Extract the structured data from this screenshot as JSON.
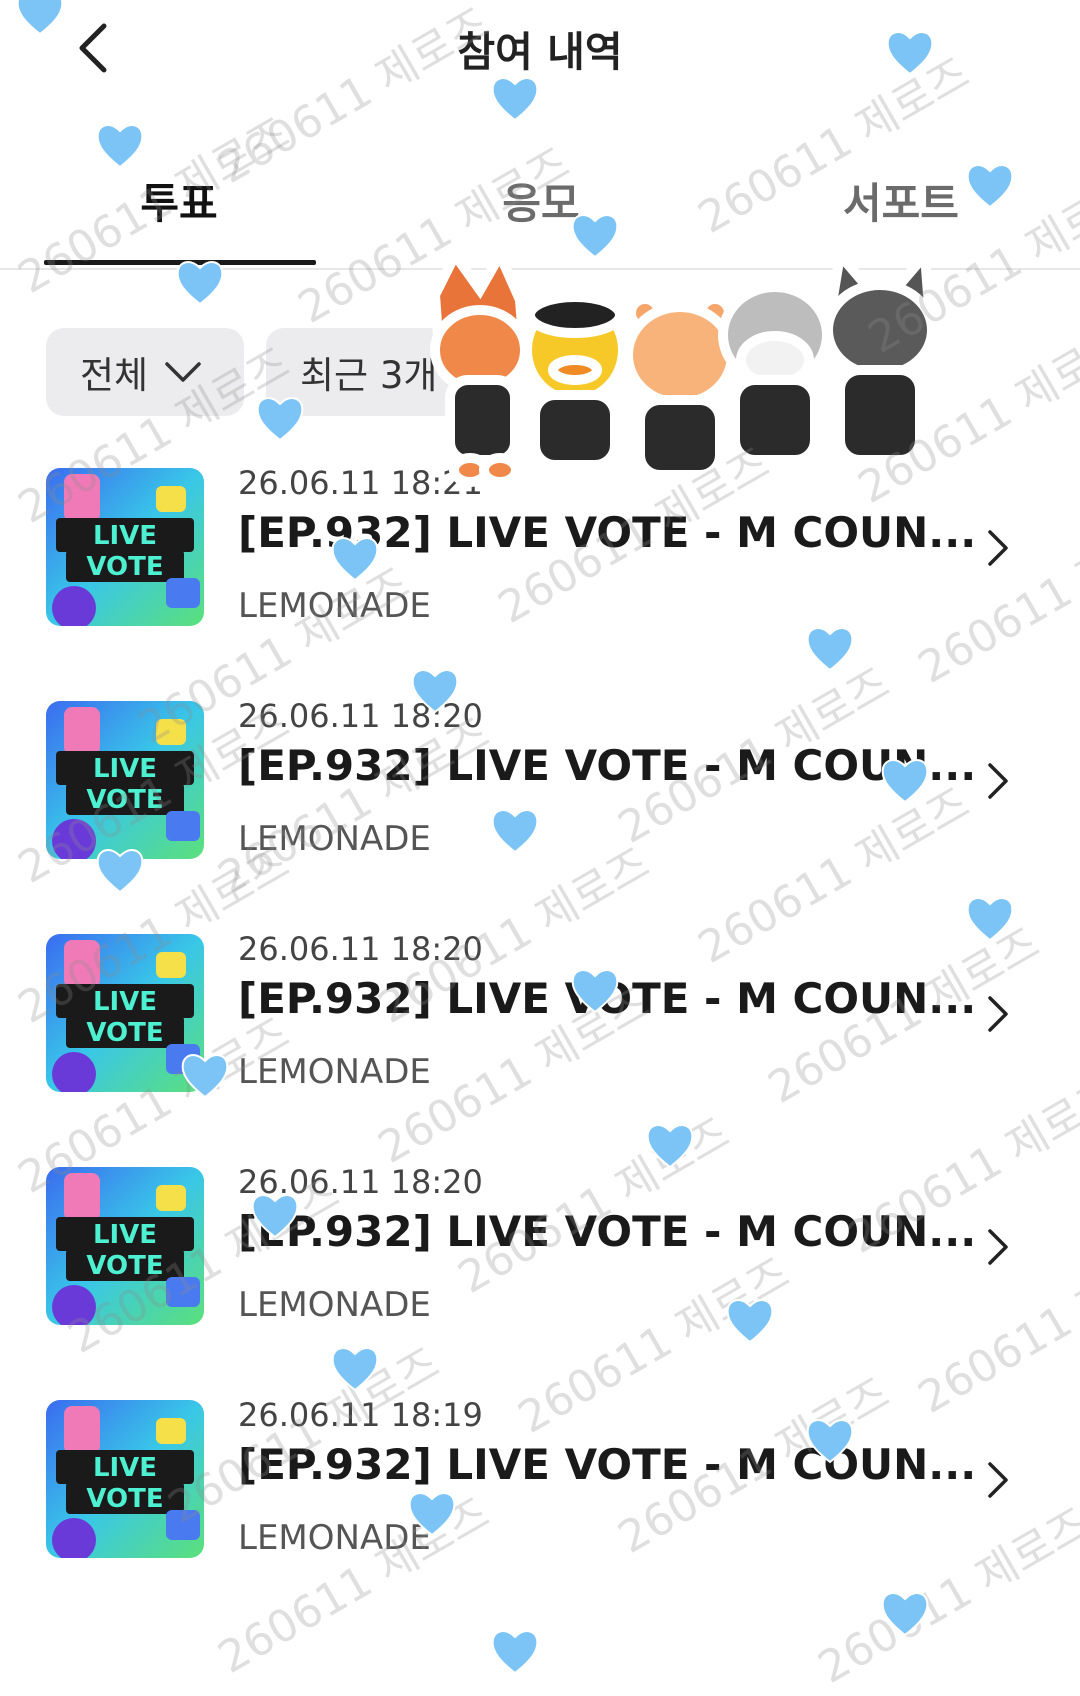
{
  "header": {
    "title": "참여 내역",
    "back_icon": "chevron-left-icon"
  },
  "tabs": [
    {
      "label": "투표",
      "active": true
    },
    {
      "label": "응모",
      "active": false
    },
    {
      "label": "서포트",
      "active": false
    }
  ],
  "filters": {
    "scope": {
      "label": "전체",
      "icon": "chevron-down-icon"
    },
    "period": {
      "label": "최근 3개"
    }
  },
  "items": [
    {
      "date": "26.06.11 18:21",
      "title": "[EP.932] LIVE VOTE - M COUN...",
      "source": "LEMONADE",
      "thumb_text": [
        "LIVE",
        "VOTE"
      ]
    },
    {
      "date": "26.06.11 18:20",
      "title": "[EP.932] LIVE VOTE - M COUN...",
      "source": "LEMONADE",
      "thumb_text": [
        "LIVE",
        "VOTE"
      ]
    },
    {
      "date": "26.06.11 18:20",
      "title": "[EP.932] LIVE VOTE - M COUN...",
      "source": "LEMONADE",
      "thumb_text": [
        "LIVE",
        "VOTE"
      ]
    },
    {
      "date": "26.06.11 18:20",
      "title": "[EP.932] LIVE VOTE - M COUN...",
      "source": "LEMONADE",
      "thumb_text": [
        "LIVE",
        "VOTE"
      ]
    },
    {
      "date": "26.06.11 18:19",
      "title": "[EP.932] LIVE VOTE - M COUN...",
      "source": "LEMONADE",
      "thumb_text": [
        "LIVE",
        "VOTE"
      ]
    }
  ],
  "watermark": "260611 제로즈",
  "colors": {
    "heart": "#7cc4f5",
    "active_tab": "#111111",
    "filter_bg": "#ececee"
  }
}
